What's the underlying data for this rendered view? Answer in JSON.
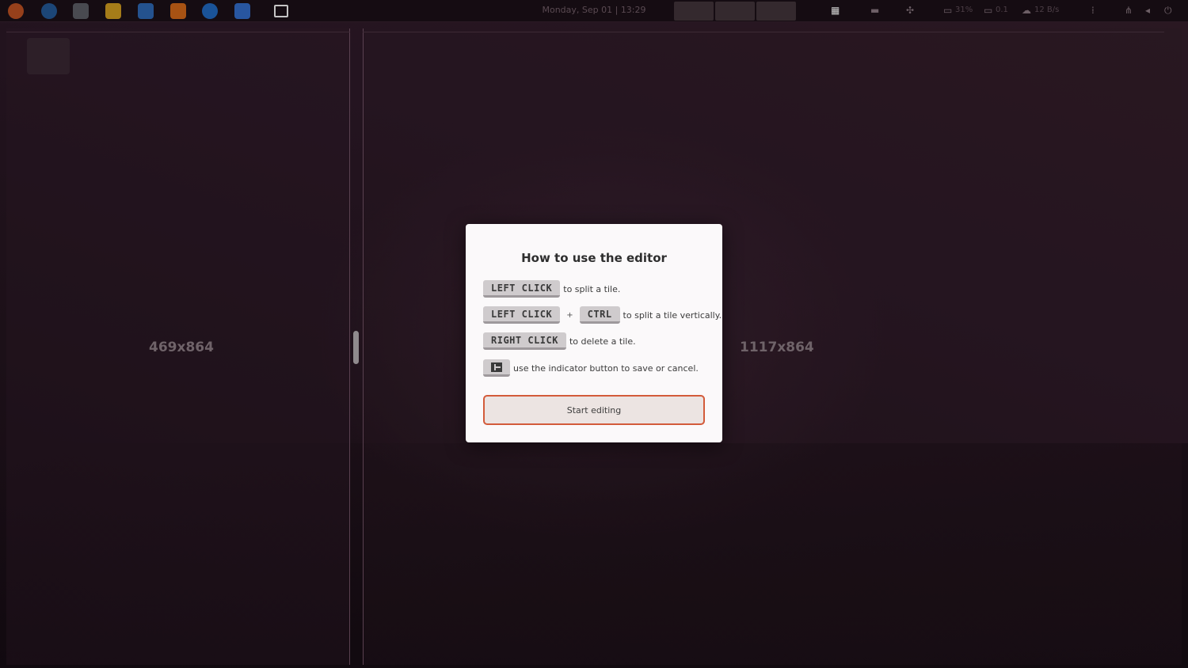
{
  "topbar": {
    "clock": "Monday, Sep 01 | 13:29",
    "tray": {
      "cpu": "31%",
      "display": "0.1",
      "net": "12 B/s"
    }
  },
  "tiles": {
    "left_size": "469x864",
    "right_size": "1117x864"
  },
  "dialog": {
    "title": "How to use the editor",
    "rows": [
      {
        "key": "LEFT CLICK",
        "desc": "to split a tile."
      },
      {
        "key": "LEFT CLICK",
        "plus": "+",
        "key2": "CTRL",
        "desc": "to split a tile vertically."
      },
      {
        "key": "RIGHT CLICK",
        "desc": "to delete a tile."
      },
      {
        "icon": "layout-indicator-icon",
        "desc": "use the indicator button to save or cancel."
      }
    ],
    "start_button": "Start editing"
  },
  "colors": {
    "accent": "#d35b3a",
    "dialog_bg": "#fbf9fa",
    "key_bg": "#cfcbcd"
  }
}
